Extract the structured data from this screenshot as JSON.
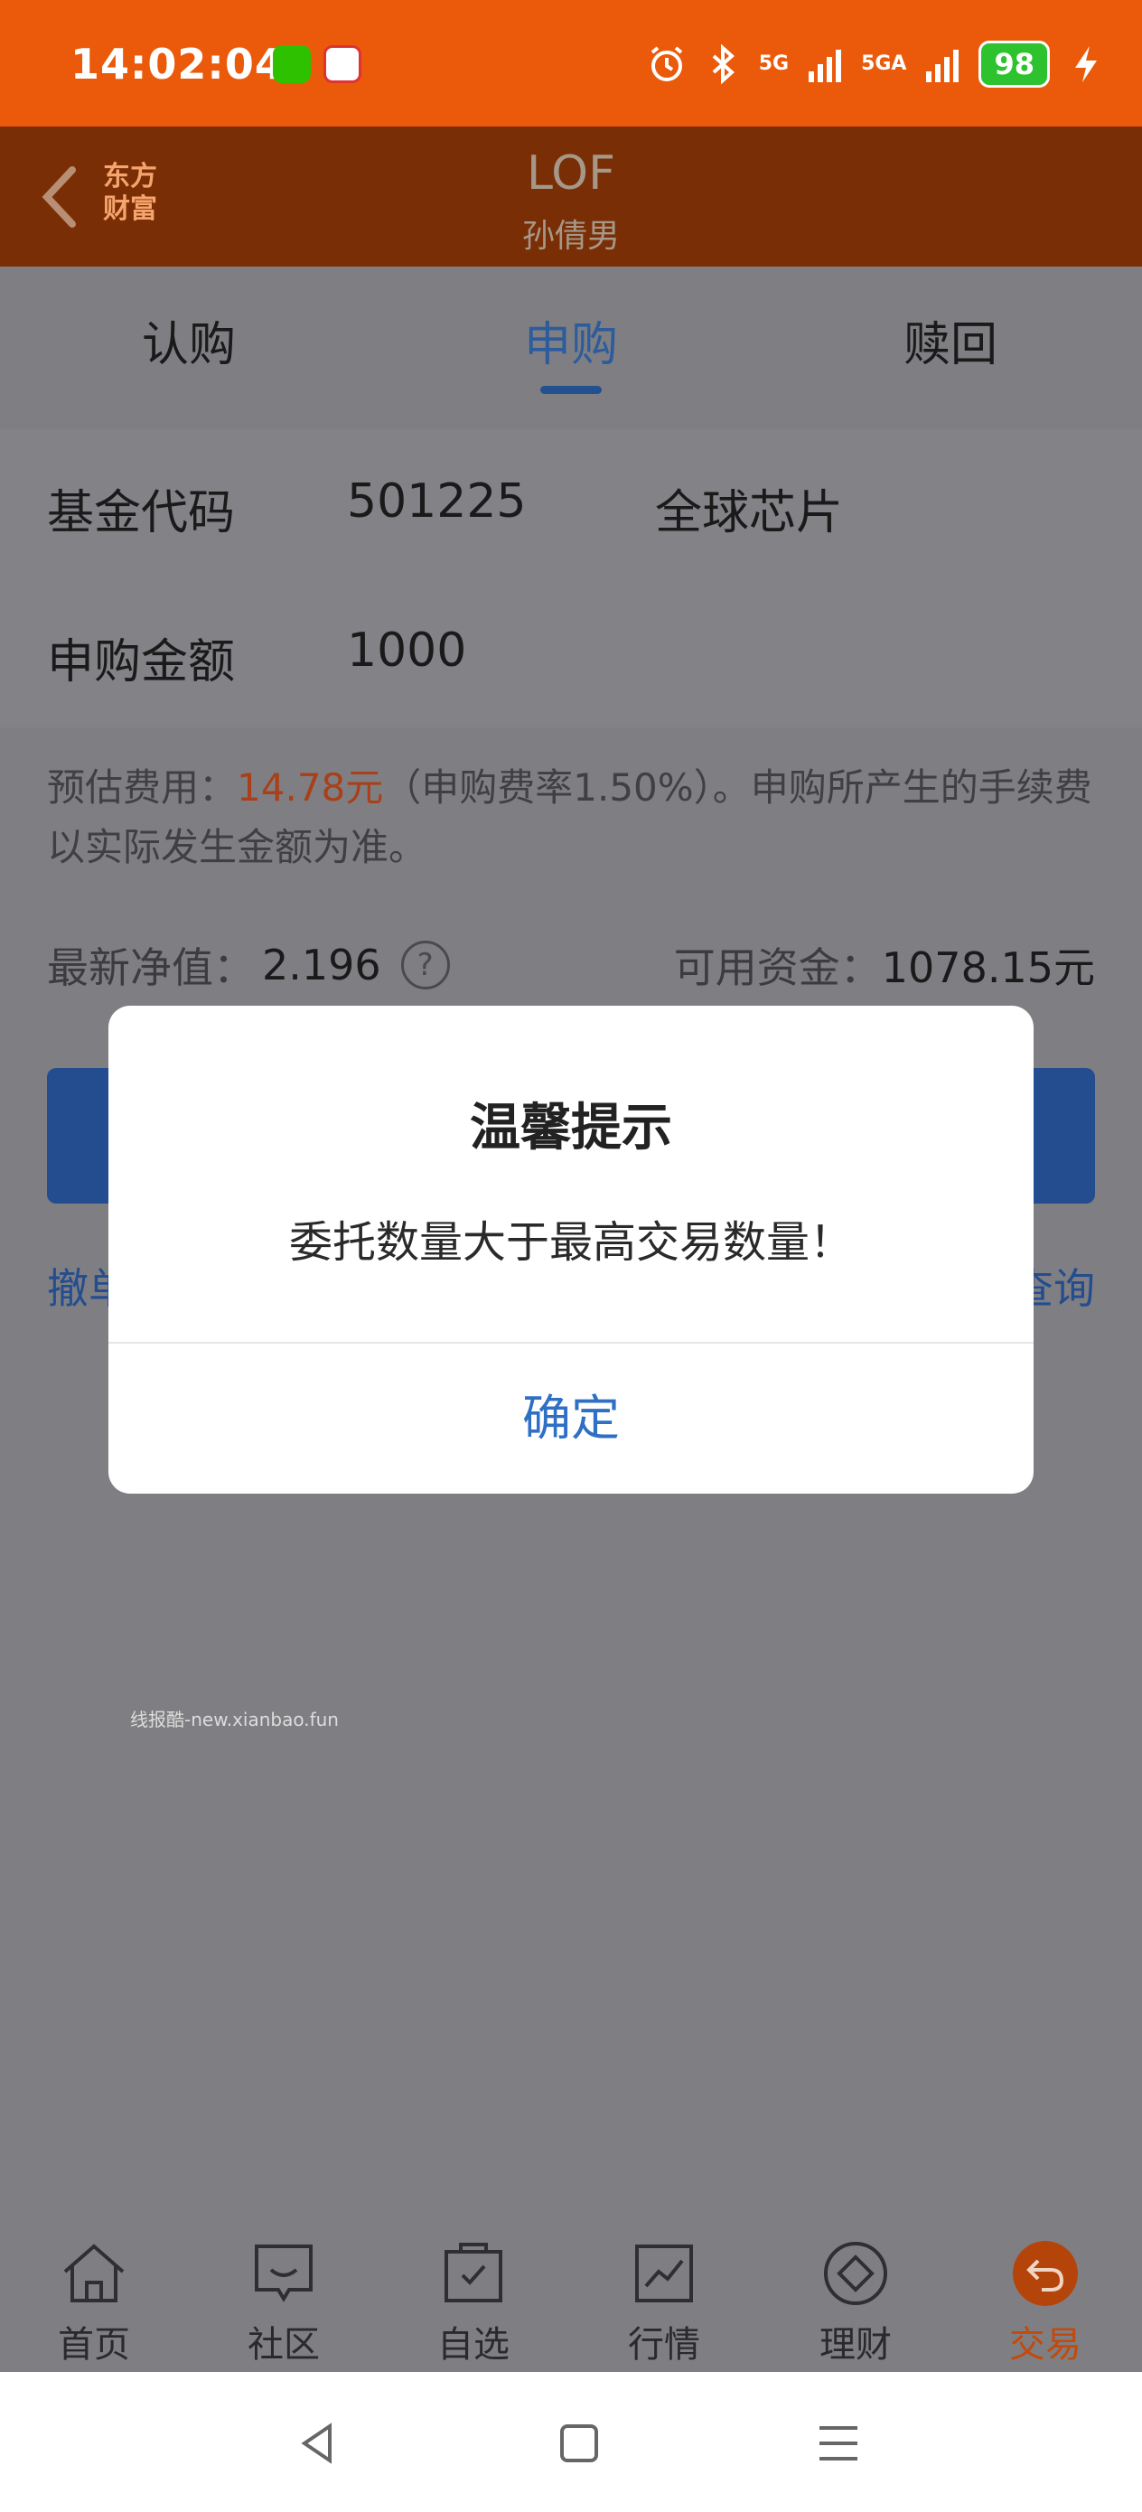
{
  "status_bar": {
    "time": "14:02:04",
    "battery": "98",
    "signal_1": "5G",
    "signal_2": "5GA"
  },
  "header": {
    "brand_line1": "东方",
    "brand_line2": "财富",
    "title": "LOF",
    "subtitle": "孙倩男"
  },
  "tabs": [
    {
      "label": "认购",
      "active": false
    },
    {
      "label": "申购",
      "active": true
    },
    {
      "label": "赎回",
      "active": false
    }
  ],
  "form": {
    "fund_code_label": "基金代码",
    "fund_code": "501225",
    "fund_name": "全球芯片",
    "amount_label": "申购金额",
    "amount": "1000",
    "fee_prefix": "预估费用：",
    "fee_amount": "14.78元",
    "fee_suffix": "（申购费率1.50%）。申购所产生的手续费以实际发生金额为准。",
    "nav_label": "最新净值：",
    "nav_value": "2.196",
    "help_mark": "?",
    "funds_label": "可用资金：",
    "funds_value": "1078.15元",
    "cancel_link": "撤单",
    "query_link": "查询"
  },
  "dialog": {
    "title": "温馨提示",
    "message": "委托数量大于最高交易数量！",
    "confirm": "确定"
  },
  "watermark": "线报酷-new.xianbao.fun",
  "bottom_nav": [
    {
      "label": "首页",
      "icon": "home-icon",
      "active": false
    },
    {
      "label": "社区",
      "icon": "community-icon",
      "active": false
    },
    {
      "label": "自选",
      "icon": "watchlist-icon",
      "active": false
    },
    {
      "label": "行情",
      "icon": "market-icon",
      "active": false
    },
    {
      "label": "理财",
      "icon": "wealth-icon",
      "active": false
    },
    {
      "label": "交易",
      "icon": "trade-icon",
      "active": true
    }
  ],
  "colors": {
    "status_bar": "#ea5a0a",
    "accent_blue": "#2f6fc4",
    "fee_amount": "#a8401a",
    "trade_active": "#c24a0c"
  }
}
